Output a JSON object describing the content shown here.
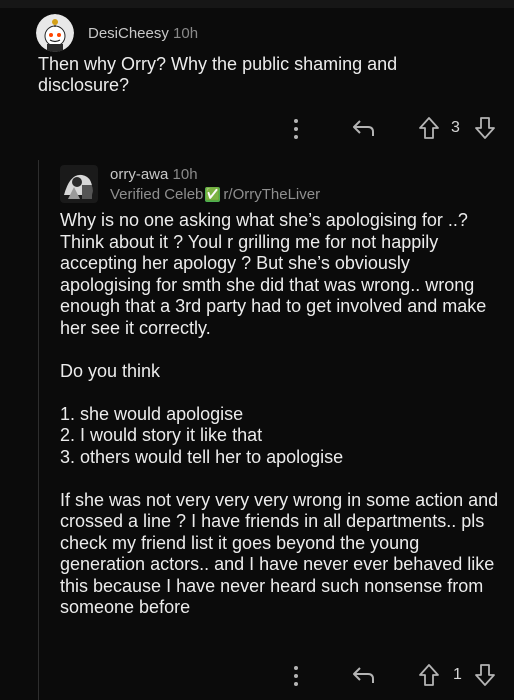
{
  "comment": {
    "username": "DesiCheesy",
    "time": "10h",
    "text": "Then why Orry? Why the public shaming and disclosure?",
    "vote_count": "3",
    "icons": {
      "more": "more-vertical-icon",
      "reply": "reply-arrow-icon",
      "upvote": "upvote-arrow-icon",
      "downvote": "downvote-arrow-icon"
    }
  },
  "reply": {
    "username": "orry-awa",
    "time": "10h",
    "flair": "Verified Celeb",
    "flair_emoji": "✅",
    "subreddit": "r/OrryTheLiver",
    "paragraphs": [
      "Why is no one asking what she’s apologising for ..? Think about it ? Youl r grilling me for not happily accepting her apology ? But she’s obviously apologising for smth she did that was wrong.. wrong enough that a 3rd party had to get involved and make her see it correctly.",
      "Do you think"
    ],
    "list": [
      "1. she would apologise",
      "2. I would story it like that",
      "3. others would tell her to apologise"
    ],
    "closing": "If she was not very very very wrong in some action and crossed a line ? I have friends in all departments.. pls check my friend list it goes beyond the young generation actors.. and I have never ever behaved like this because I have never heard such nonsense from someone before",
    "vote_count": "1"
  },
  "colors": {
    "background": "#0b0b0b",
    "text": "#ececec",
    "muted": "#8a8a8a",
    "verified": "#4db050"
  }
}
